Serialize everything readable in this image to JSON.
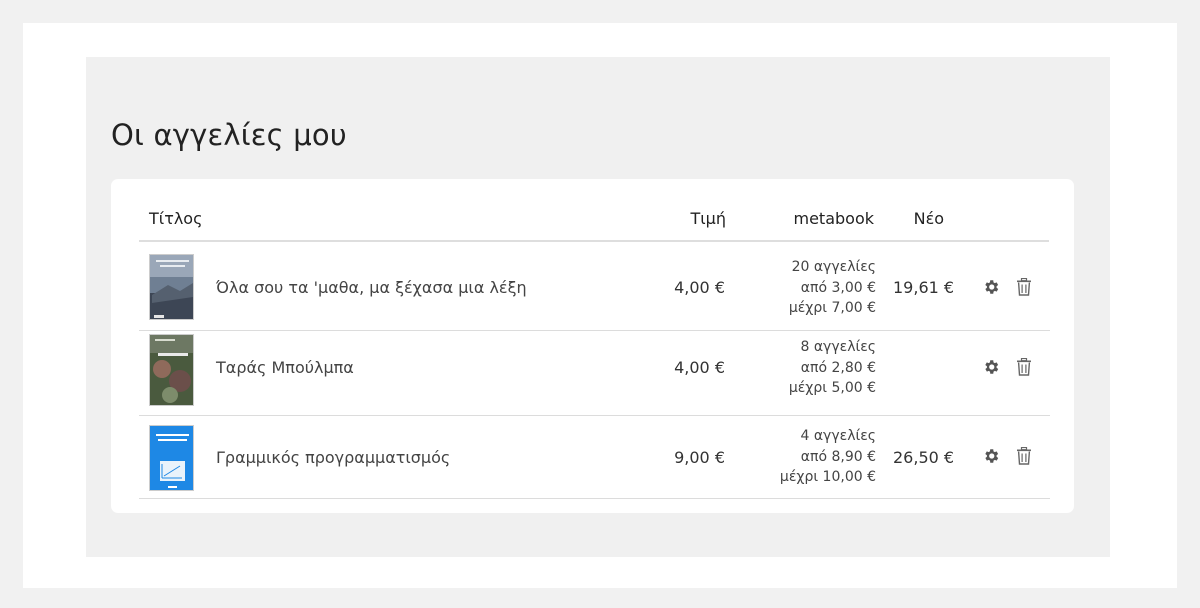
{
  "page": {
    "title": "Οι αγγελίες μου"
  },
  "table": {
    "headers": {
      "title": "Τίτλος",
      "price": "Τιμή",
      "metabook": "metabook",
      "new": "Νέο"
    },
    "rows": [
      {
        "title": "Όλα σου τα 'μαθα, μα ξέχασα μια λέξη",
        "price": "4,00 €",
        "listings": "20 αγγελίες",
        "from": "από 3,00 €",
        "to": "μέχρι 7,00 €",
        "new_price": "19,61 €"
      },
      {
        "title": "Ταράς Μπούλμπα",
        "price": "4,00 €",
        "listings": "8 αγγελίες",
        "from": "από 2,80 €",
        "to": "μέχρι 5,00 €",
        "new_price": ""
      },
      {
        "title": "Γραμμικός προγραμματισμός",
        "price": "9,00 €",
        "listings": "4 αγγελίες",
        "from": "από 8,90 €",
        "to": "μέχρι 10,00 €",
        "new_price": "26,50 €"
      }
    ]
  },
  "icons": {
    "edit": "gear-icon",
    "delete": "trash-icon"
  },
  "colors": {
    "background": "#f1f1f1",
    "panel": "#f0f0f0",
    "card": "#ffffff",
    "text": "#333333",
    "icon": "#555555",
    "cover3_blue": "#1e88e5"
  }
}
